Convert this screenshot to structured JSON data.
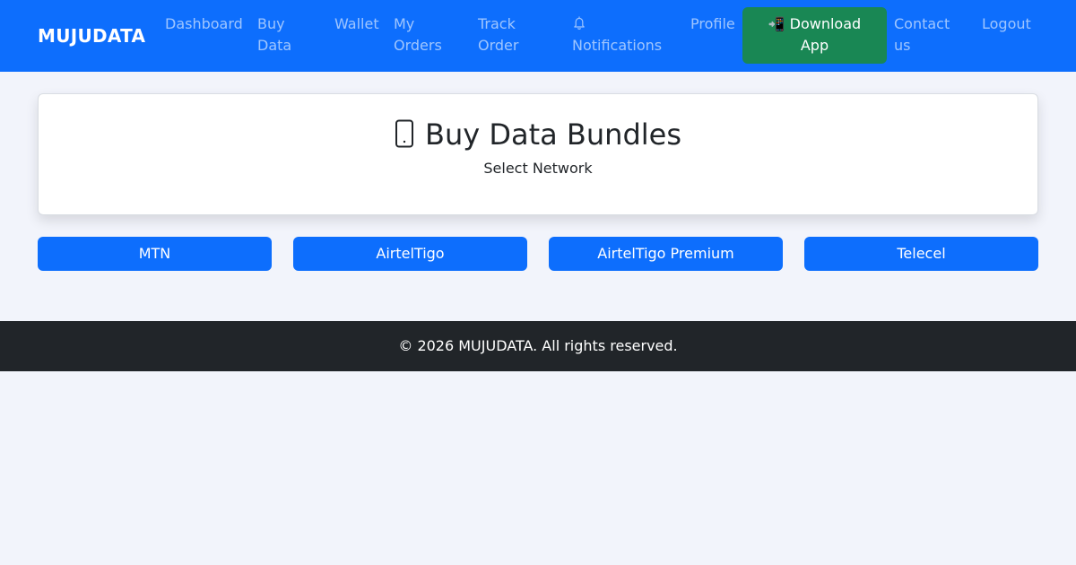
{
  "navbar": {
    "brand": "MUJUDATA",
    "links": [
      {
        "label_line1": "Dashboard",
        "label_line2": ""
      },
      {
        "label_line1": "Buy",
        "label_line2": "Data"
      },
      {
        "label_line1": "Wallet",
        "label_line2": ""
      },
      {
        "label_line1": "My",
        "label_line2": "Orders"
      },
      {
        "label_line1": "Track",
        "label_line2": "Order"
      },
      {
        "label_line1": "",
        "label_line2": "Notifications",
        "icon": "bell-icon"
      },
      {
        "label_line1": "Profile",
        "label_line2": ""
      },
      {
        "label_line1": "Contact",
        "label_line2": "us"
      },
      {
        "label_line1": "Logout",
        "label_line2": ""
      }
    ],
    "download": {
      "icon": "📲",
      "label_line1": "Download",
      "label_line2": "App"
    }
  },
  "card": {
    "icon": "phone-icon",
    "title": "Buy Data Bundles",
    "subtitle": "Select Network"
  },
  "networks": [
    {
      "label": "MTN"
    },
    {
      "label": "AirtelTigo"
    },
    {
      "label": "AirtelTigo Premium"
    },
    {
      "label": "Telecel"
    }
  ],
  "footer": {
    "text": "© 2026 MUJUDATA. All rights reserved."
  },
  "colors": {
    "primary": "#0d6efd",
    "success": "#198754",
    "dark": "#212529",
    "page_bg": "#f2f4fb"
  }
}
